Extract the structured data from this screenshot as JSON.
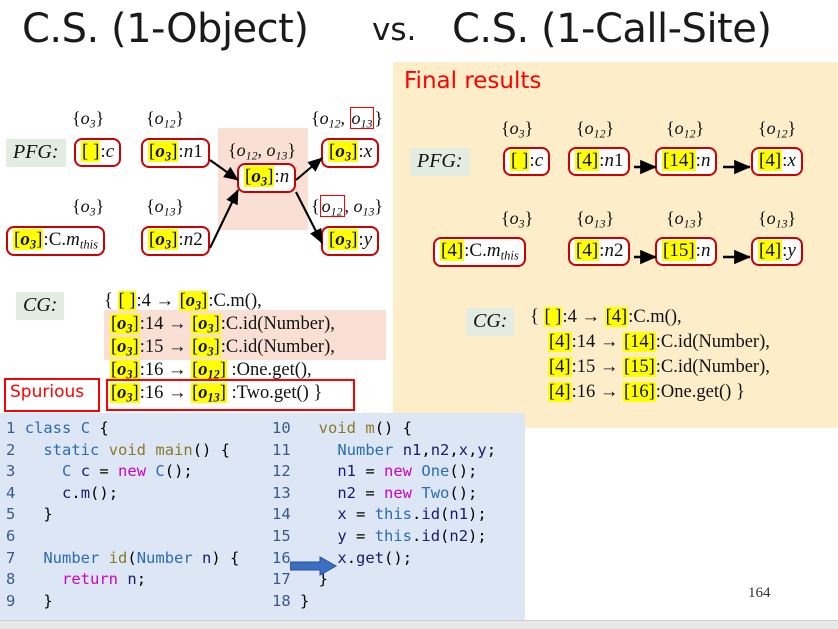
{
  "title": {
    "left": "C.S. (1-Object)",
    "vs": "vs.",
    "right": "C.S. (1-Call-Site)"
  },
  "final_panel": {
    "heading": "Final results"
  },
  "labels": {
    "pfg": "PFG:",
    "cg": "CG:",
    "spurious": "Spurious"
  },
  "left_pfg": {
    "row1": {
      "pts": [
        "{o3}",
        "{o12}",
        "{o12, o13}",
        "{o12, o13}"
      ],
      "nodes": [
        "[ ]:c",
        "[o3]:n1",
        "[o3]:n",
        "[o3]:x"
      ]
    },
    "row2": {
      "pts": [
        "{o3}",
        "{o13}",
        "{o12, o13}"
      ],
      "nodes": [
        "[o3]:C.mthis",
        "[o3]:n2",
        "[o3]:y"
      ]
    }
  },
  "left_cg": {
    "lines": [
      "{ [ ]:4 → [o3]:C.m(),",
      "[o3]:14 → [o3]:C.id(Number),",
      "[o3]:15 → [o3]:C.id(Number),",
      "[o3]:16 → [o12]:One.get(),",
      "[o3]:16 → [o13]:Two.get() }"
    ]
  },
  "right_pfg": {
    "row1": {
      "pts": [
        "{o3}",
        "{o12}",
        "{o12}",
        "{o12}"
      ],
      "nodes": [
        "[ ]:c",
        "[4]:n1",
        "[14]:n",
        "[4]:x"
      ]
    },
    "row2": {
      "pts": [
        "{o3}",
        "{o13}",
        "{o13}",
        "{o13}"
      ],
      "nodes": [
        "[4]:C.mthis",
        "[4]:n2",
        "[15]:n",
        "[4]:y"
      ]
    }
  },
  "right_cg": {
    "lines": [
      "{ [ ]:4 → [4]:C.m(),",
      "[4]:14 → [14]:C.id(Number),",
      "[4]:15 → [15]:C.id(Number),",
      "[4]:16 → [16]:One.get() }"
    ]
  },
  "code": {
    "left_lines": [
      {
        "n": "1",
        "text": "class C {"
      },
      {
        "n": "2",
        "text": "  static void main() {"
      },
      {
        "n": "3",
        "text": "    C c = new C();"
      },
      {
        "n": "4",
        "text": "    c.m();"
      },
      {
        "n": "5",
        "text": "  }"
      },
      {
        "n": "6",
        "text": ""
      },
      {
        "n": "7",
        "text": "  Number id(Number n) {"
      },
      {
        "n": "8",
        "text": "    return n;"
      },
      {
        "n": "9",
        "text": "  }"
      }
    ],
    "right_lines": [
      {
        "n": "10",
        "text": "  void m() {"
      },
      {
        "n": "11",
        "text": "    Number n1,n2,x,y;"
      },
      {
        "n": "12",
        "text": "    n1 = new One();"
      },
      {
        "n": "13",
        "text": "    n2 = new Two();"
      },
      {
        "n": "14",
        "text": "    x = this.id(n1);"
      },
      {
        "n": "15",
        "text": "    y = this.id(n2);"
      },
      {
        "n": "16",
        "text": "    x.get();",
        "marker": "arrow"
      },
      {
        "n": "17",
        "text": "  }"
      },
      {
        "n": "18",
        "text": "}"
      }
    ]
  },
  "page_number": "164",
  "colors": {
    "accent_red": "#ff0000",
    "node_border": "#cc0000",
    "highlight_yellow": "#ffff00",
    "panel_yellow": "#fdeec9",
    "pink_emphasis": "#fae0d4",
    "code_bg": "#dde6f5",
    "label_bg": "#e3ece1"
  }
}
